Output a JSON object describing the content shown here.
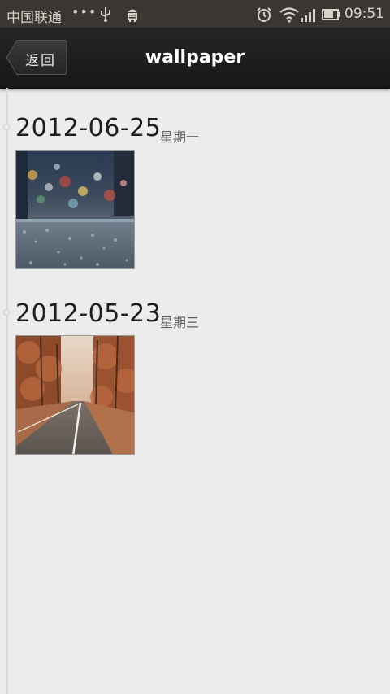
{
  "status_bar": {
    "carrier": "中国联通",
    "dots": "•••",
    "time": "09:51",
    "icons": [
      "usb-icon",
      "android-debug-icon",
      "alarm-icon",
      "wifi-icon",
      "signal-icon",
      "battery-icon"
    ]
  },
  "header": {
    "back_label": "返回",
    "title": "wallpaper"
  },
  "timeline": {
    "groups": [
      {
        "date": "2012-06-25",
        "weekday": "星期一",
        "image": "city-bokeh-rain-photo"
      },
      {
        "date": "2012-05-23",
        "weekday": "星期三",
        "image": "autumn-road-photo"
      }
    ]
  },
  "colors": {
    "status_bar_bg": "#3a3632",
    "title_bar_bg": "#1c1c1c",
    "page_bg": "#ececec",
    "timeline_line": "#d9d9d9"
  }
}
